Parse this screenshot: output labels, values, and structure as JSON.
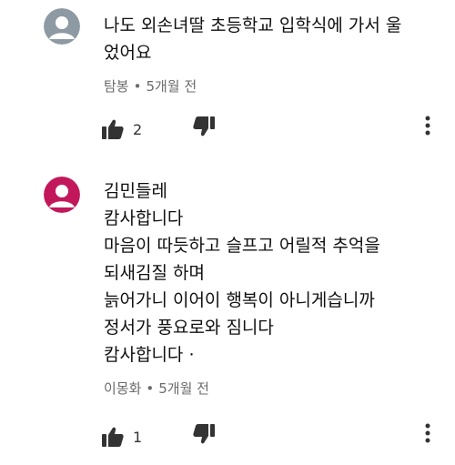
{
  "comments": [
    {
      "avatar_color": "#8e9aa3",
      "lines": [
        "나도 외손녀딸 초등학교 입학식에 가서 울",
        "었어요"
      ],
      "author": "탐봉",
      "time": "5개월 전",
      "likes": "2"
    },
    {
      "avatar_color": "#c2185b",
      "lines": [
        "김민들레",
        "캄사합니다",
        "마음이 따듯하고 슬프고 어릴적 추억을",
        "되새김질  하며",
        "늙어가니 이어이 행복이 아니게습니까",
        "정서가 풍요로와  짐니다",
        "캄사합니다  ·"
      ],
      "author": "이몽화",
      "time": "5개월 전",
      "likes": "1"
    }
  ],
  "icons": {
    "like": "thumbs-up-icon",
    "dislike": "thumbs-down-icon",
    "more": "vertical-ellipsis-icon",
    "avatar": "default-profile-avatar-icon"
  },
  "meta_separator": "•"
}
